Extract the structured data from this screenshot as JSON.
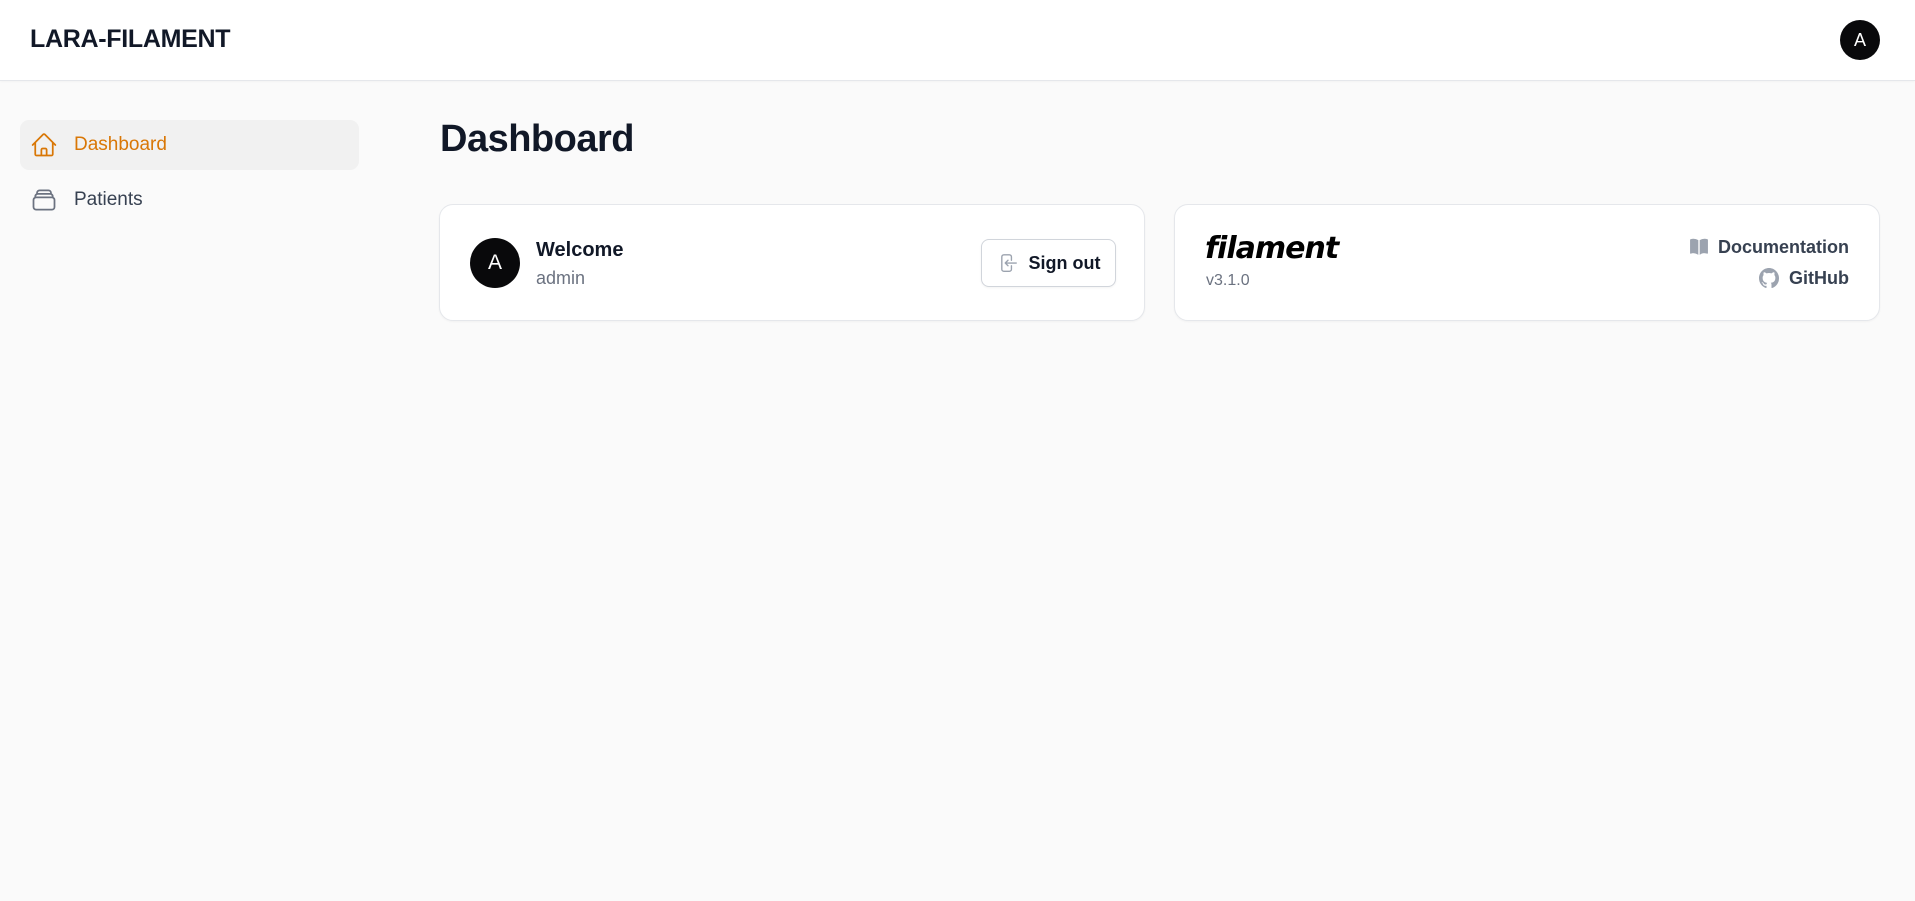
{
  "app": {
    "brand": "LARA-FILAMENT",
    "user_initial": "A"
  },
  "sidebar": {
    "items": [
      {
        "label": "Dashboard",
        "icon": "home-icon",
        "active": true
      },
      {
        "label": "Patients",
        "icon": "stack-icon",
        "active": false
      }
    ]
  },
  "main": {
    "title": "Dashboard",
    "welcome": {
      "avatar_initial": "A",
      "title": "Welcome",
      "subtitle": "admin",
      "signout_label": "Sign out"
    },
    "info": {
      "logo_text": "filament",
      "version": "v3.1.0",
      "docs_label": "Documentation",
      "github_label": "GitHub"
    }
  },
  "colors": {
    "accent": "#d97706",
    "avatar_bg": "#09090b",
    "page_bg": "#fafafa"
  }
}
